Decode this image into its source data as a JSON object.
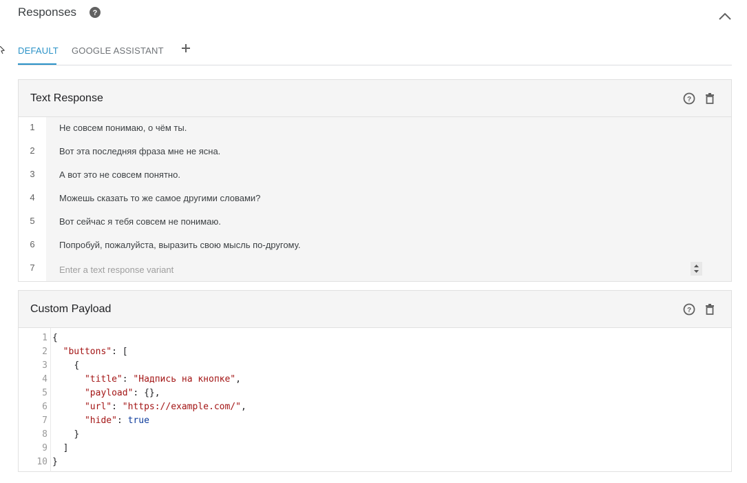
{
  "section": {
    "title": "Responses",
    "help_icon": "help-circle-icon",
    "collapse_icon": "chevron-up-icon"
  },
  "tabs": {
    "items": [
      {
        "label": "DEFAULT",
        "active": true
      },
      {
        "label": "GOOGLE ASSISTANT",
        "active": false
      }
    ],
    "add_icon": "plus-icon"
  },
  "text_response": {
    "title": "Text Response",
    "help_icon": "help-outline-icon",
    "delete_icon": "trash-icon",
    "rows": [
      {
        "num": "1",
        "text": "Не совсем понимаю, о чём ты."
      },
      {
        "num": "2",
        "text": "Вот эта последняя фраза мне не ясна."
      },
      {
        "num": "3",
        "text": "А вот это не совсем понятно."
      },
      {
        "num": "4",
        "text": "Можешь сказать то же самое другими словами?"
      },
      {
        "num": "5",
        "text": "Вот сейчас я тебя совсем не понимаю."
      },
      {
        "num": "6",
        "text": "Попробуй, пожалуйста, выразить свою мысль по-другому."
      }
    ],
    "new_row": {
      "num": "7",
      "placeholder": "Enter a text response variant"
    }
  },
  "custom_payload": {
    "title": "Custom Payload",
    "help_icon": "help-outline-icon",
    "delete_icon": "trash-icon",
    "line_numbers": [
      "1",
      "2",
      "3",
      "4",
      "5",
      "6",
      "7",
      "8",
      "9",
      "10"
    ],
    "code": {
      "open_brace": "{",
      "buttons_key": "\"buttons\"",
      "colon_bracket": ": [",
      "obj_open": "{",
      "title_key": "\"title\"",
      "title_value": "\"Надпись на кнопке\"",
      "payload_key": "\"payload\"",
      "payload_value": "{}",
      "url_key": "\"url\"",
      "url_value": "\"https://example.com/\"",
      "hide_key": "\"hide\"",
      "hide_value": "true",
      "obj_close": "}",
      "array_close": "]",
      "close_brace": "}"
    }
  },
  "colors": {
    "accent": "#2a92c7",
    "json_key": "#a31515",
    "json_keyword": "#0b3a9b"
  }
}
